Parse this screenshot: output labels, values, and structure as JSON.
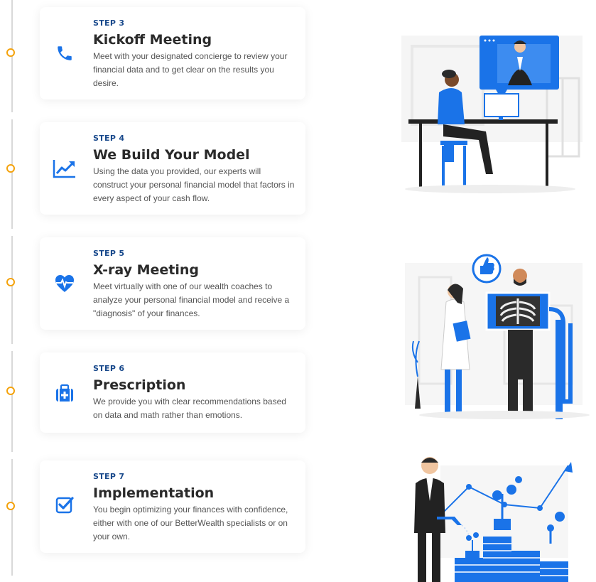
{
  "steps": [
    {
      "label": "STEP 3",
      "title": "Kickoff Meeting",
      "description": "Meet with your designated concierge to review your financial data and to get clear on the results you desire.",
      "icon": "phone-icon"
    },
    {
      "label": "STEP 4",
      "title": "We Build Your Model",
      "description": "Using the data you provided, our experts will construct your personal financial model that factors in every aspect of your cash flow.",
      "icon": "trending-up-icon"
    },
    {
      "label": "STEP 5",
      "title": "X-ray Meeting",
      "description": "Meet virtually with one of our wealth coaches to analyze your personal financial model and receive a \"diagnosis\" of your finances.",
      "icon": "heartbeat-icon"
    },
    {
      "label": "STEP 6",
      "title": "Prescription",
      "description": "We provide you with clear recommendations based on data and math rather than emotions.",
      "icon": "medical-kit-icon"
    },
    {
      "label": "STEP 7",
      "title": "Implementation",
      "description": "You begin optimizing your finances with confidence, either with one of our BetterWealth specialists or on your own.",
      "icon": "checkbox-icon"
    }
  ],
  "colors": {
    "accent_blue": "#1a73e8",
    "dark_blue": "#1a4a8c",
    "timeline_dot": "#f4a20b"
  }
}
